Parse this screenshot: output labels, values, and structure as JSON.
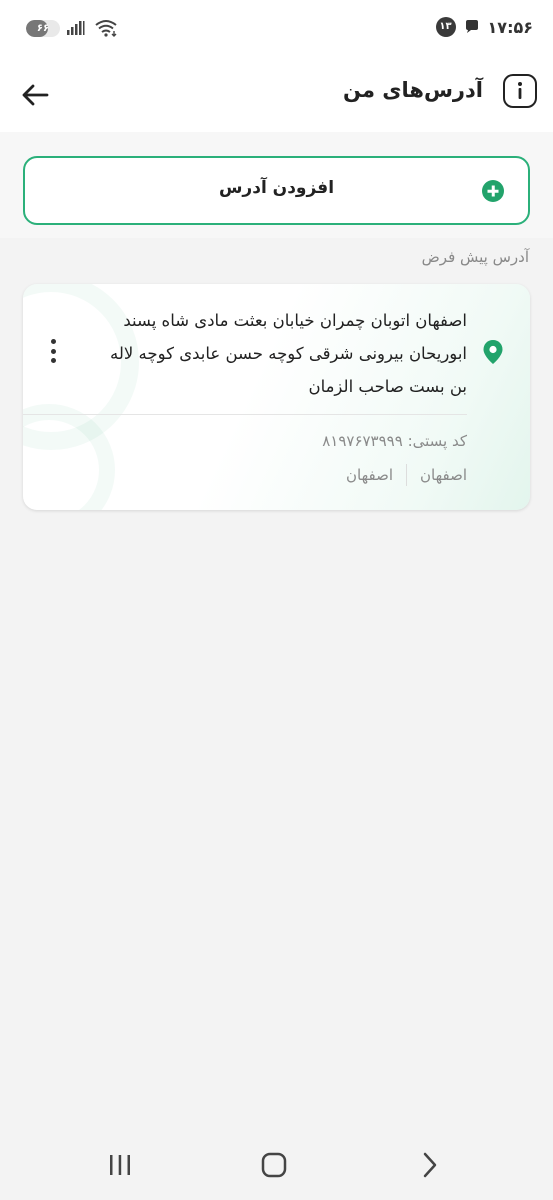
{
  "status_bar": {
    "time": "۱۷:۵۶",
    "notification_count": "۱۳",
    "battery_percent": "۶۶",
    "battery_level": 0.66,
    "icons": [
      "battery-icon",
      "signal-icon",
      "wifi-icon",
      "chat-notification-icon"
    ]
  },
  "header": {
    "title": "آدرس‌های من",
    "back_icon": "arrow-left-icon",
    "info_icon": "info-icon"
  },
  "add_address": {
    "label": "افزودن آدرس",
    "icon": "plus-circle-icon"
  },
  "section_label": "آدرس پیش فرض",
  "address_card": {
    "lines": [
      "اصفهان اتوبان چمران خیابان بعثت مادی شاه پسند",
      "ابوریحان بیرونی شرقی کوچه حسن عابدی کوچه لاله",
      "بن بست صاحب الزمان"
    ],
    "postal_code": "کد پستی: ۸۱۹۷۶۷۳۹۹۹",
    "province": "اصفهان",
    "city": "اصفهان",
    "pin_icon": "location-pin-icon",
    "menu_icon": "more-vertical-icon"
  },
  "nav_bar": {
    "icons": [
      "recent-apps-icon",
      "home-icon",
      "back-icon"
    ]
  },
  "colors": {
    "accent": "#22a36b",
    "border_accent": "#2bb07a"
  }
}
